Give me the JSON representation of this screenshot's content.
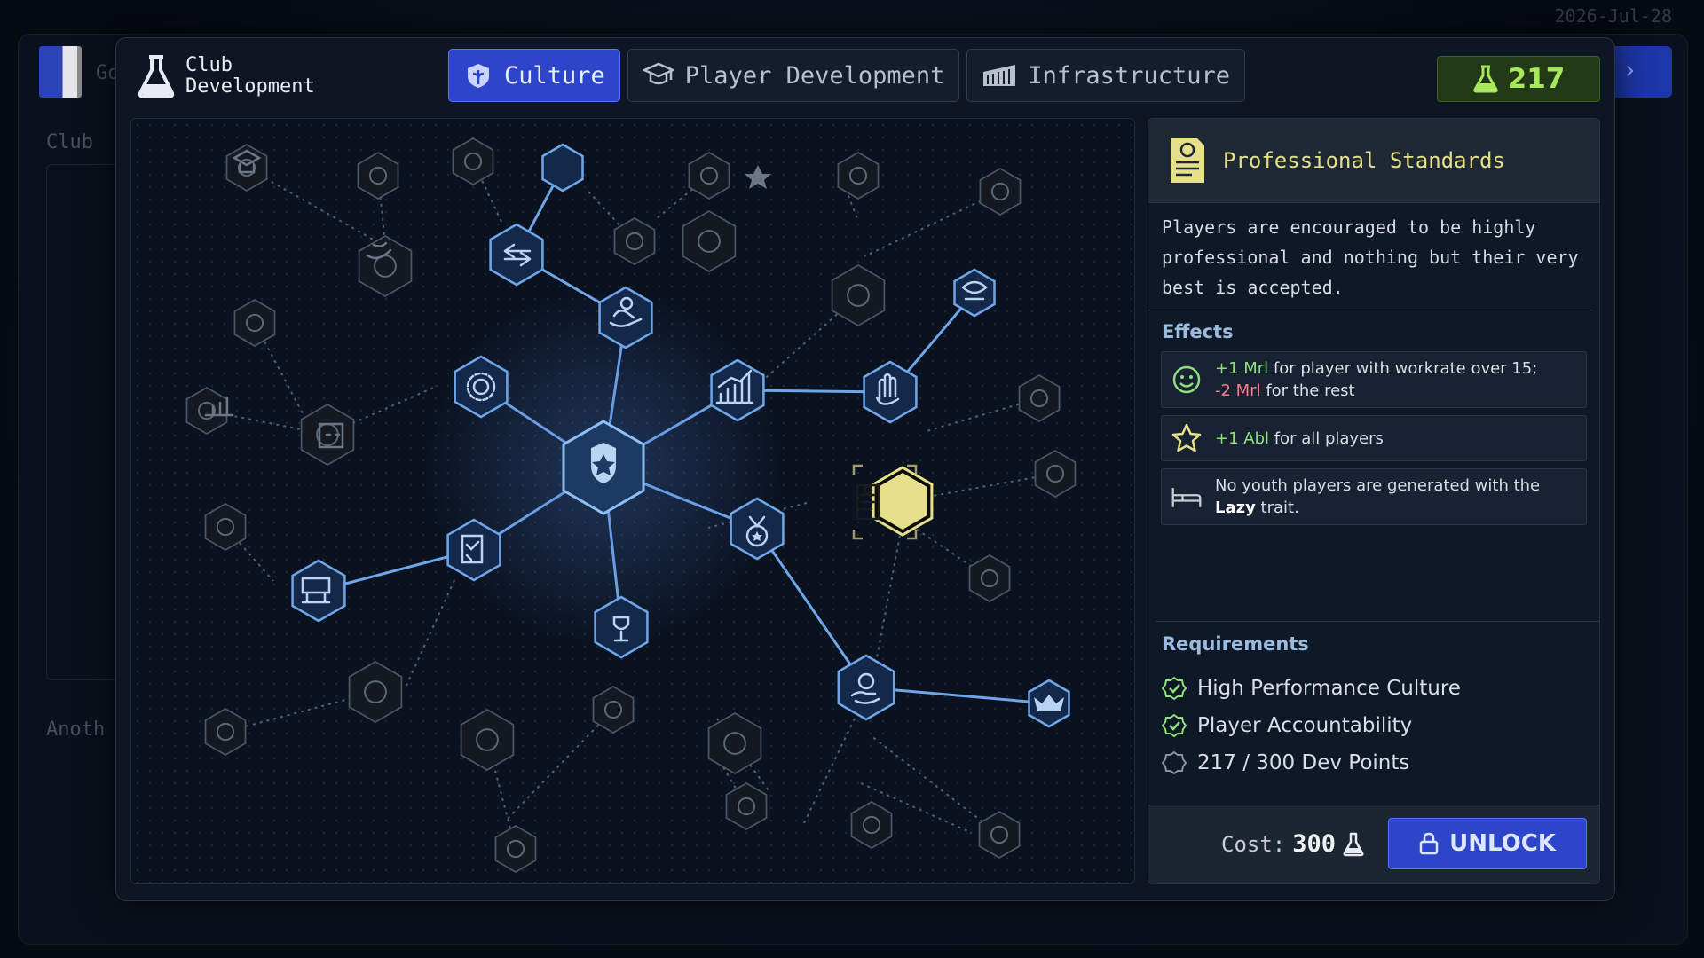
{
  "background": {
    "left_label_1": "Go",
    "left_label_2": "Club",
    "left_label_3": "Anoth",
    "date": "2026-Jul-28"
  },
  "modal": {
    "title": "Club\nDevelopment",
    "tabs": [
      {
        "label": "Culture",
        "icon": "culture-icon",
        "active": true
      },
      {
        "label": "Player Development",
        "icon": "mortarboard-icon",
        "active": false
      },
      {
        "label": "Infrastructure",
        "icon": "stadium-icon",
        "active": false
      }
    ],
    "dev_points": "217"
  },
  "panel": {
    "title": "Professional Standards",
    "description": "Players are encouraged to be highly professional and nothing but their very best is accepted.",
    "effects_label": "Effects",
    "effects": [
      {
        "icon": "smiley-icon",
        "a_green": "+1 Mrl",
        "a_text": " for player with workrate over 15;",
        "b_red": "-2 Mrl",
        "b_text": " for the rest"
      },
      {
        "icon": "star-icon",
        "a_green": "+1 Abl",
        "a_text": " for all players"
      },
      {
        "icon": "bed-icon",
        "a_text": "No youth players are generated with the ",
        "bold": "Lazy",
        "tail": " trait."
      }
    ],
    "requirements_label": "Requirements",
    "requirements": [
      {
        "label": "High Performance Culture",
        "met": true
      },
      {
        "label": "Player Accountability",
        "met": true
      },
      {
        "label": "217 / 300 Dev Points",
        "met": false
      }
    ],
    "cost_label": "Cost:",
    "cost_value": "300",
    "unlock_label": "UNLOCK"
  },
  "colors": {
    "accent": "#2d45c8",
    "active_node": "#6fa6e8",
    "selected": "#e6e08a",
    "positive": "#8de07a",
    "negative": "#ff7a8a",
    "points": "#a8e85a"
  }
}
